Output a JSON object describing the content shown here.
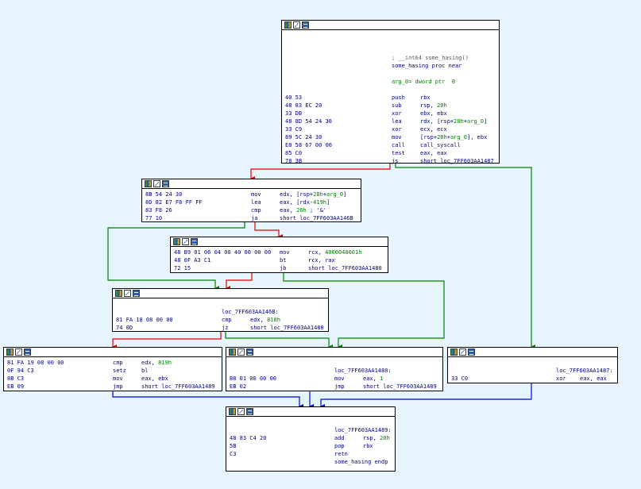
{
  "graph": {
    "colors": {
      "background": "#e6f5fd",
      "edge_taken": "#008000",
      "edge_not_taken": "#e00000",
      "edge_unconditional": "#0000e0"
    },
    "blocks": [
      {
        "id": "some_hasing",
        "rows": [
          {
            "bytes": "",
            "label": "; __int64 some_hasing()",
            "label_kind": "comment"
          },
          {
            "bytes": "",
            "label": "some_hasing proc near",
            "label_kind": "func"
          },
          {
            "bytes": "",
            "label": ""
          },
          {
            "bytes": "",
            "label": "arg_0= dword ptr  8",
            "label_kind": "arg"
          },
          {
            "bytes": "",
            "label": ""
          },
          {
            "bytes": "40 53",
            "mnem": "push",
            "ops": "rbx"
          },
          {
            "bytes": "48 83 EC 20",
            "mnem": "sub",
            "ops": "rsp, 20h"
          },
          {
            "bytes": "33 DB",
            "mnem": "xor",
            "ops": "ebx, ebx"
          },
          {
            "bytes": "48 8D 54 24 30",
            "mnem": "lea",
            "ops": "rdx, [rsp+28h+arg_0]"
          },
          {
            "bytes": "33 C9",
            "mnem": "xor",
            "ops": "ecx, ecx"
          },
          {
            "bytes": "89 5C 24 30",
            "mnem": "mov",
            "ops": "[rsp+28h+arg_0], ebx"
          },
          {
            "bytes": "E8 58 67 00 00",
            "mnem": "call",
            "ops": "call_syscall"
          },
          {
            "bytes": "85 C0",
            "mnem": "test",
            "ops": "eax, eax"
          },
          {
            "bytes": "78 3B",
            "mnem": "js",
            "ops": "short loc_7FF603AA1487"
          }
        ]
      },
      {
        "id": "blk_cmp26",
        "rows": [
          {
            "bytes": "8B 54 24 30",
            "mnem": "mov",
            "ops": "edx, [rsp+28h+arg_0]"
          },
          {
            "bytes": "8D 82 E7 F8 FF FF",
            "mnem": "lea",
            "ops": "eax, [rdx-419h]"
          },
          {
            "bytes": "83 F8 26",
            "mnem": "cmp",
            "ops": "eax, 26h ; '&'"
          },
          {
            "bytes": "77 10",
            "mnem": "ja",
            "ops": "short loc_7FF603AA146B"
          }
        ]
      },
      {
        "id": "blk_bt",
        "rows": [
          {
            "bytes": "48 B9 01 06 04 00 40 00 00 00",
            "mnem": "mov",
            "ops": "rcx, 4000040601h"
          },
          {
            "bytes": "48 0F A3 C1",
            "mnem": "bt",
            "ops": "rcx, rax"
          },
          {
            "bytes": "72 15",
            "mnem": "jb",
            "ops": "short loc_7FF603AA1480"
          }
        ]
      },
      {
        "id": "loc_146B",
        "rows": [
          {
            "bytes": "",
            "label": ""
          },
          {
            "bytes": "",
            "label": "loc_7FF603AA146B:",
            "label_kind": "label"
          },
          {
            "bytes": "81 FA 18 08 00 00",
            "mnem": "cmp",
            "ops": "edx, 818h"
          },
          {
            "bytes": "74 0D",
            "mnem": "jz",
            "ops": "short loc_7FF603AA1480"
          }
        ]
      },
      {
        "id": "blk_setz",
        "rows": [
          {
            "bytes": "81 FA 19 08 00 00",
            "mnem": "cmp",
            "ops": "edx, 819h"
          },
          {
            "bytes": "0F 94 C3",
            "mnem": "setz",
            "ops": "bl"
          },
          {
            "bytes": "8B C3",
            "mnem": "mov",
            "ops": "eax, ebx"
          },
          {
            "bytes": "EB 09",
            "mnem": "jmp",
            "ops": "short loc_7FF603AA1489"
          }
        ]
      },
      {
        "id": "loc_1480",
        "rows": [
          {
            "bytes": "",
            "label": ""
          },
          {
            "bytes": "",
            "label": "loc_7FF603AA1480:",
            "label_kind": "label"
          },
          {
            "bytes": "B8 01 00 00 00",
            "mnem": "mov",
            "ops": "eax, 1"
          },
          {
            "bytes": "EB 02",
            "mnem": "jmp",
            "ops": "short loc_7FF603AA1489"
          }
        ]
      },
      {
        "id": "loc_1487",
        "rows": [
          {
            "bytes": "",
            "label": ""
          },
          {
            "bytes": "",
            "label": "loc_7FF603AA1487:",
            "label_kind": "label"
          },
          {
            "bytes": "33 C0",
            "mnem": "xor",
            "ops": "eax, eax"
          }
        ]
      },
      {
        "id": "loc_1489",
        "rows": [
          {
            "bytes": "",
            "label": ""
          },
          {
            "bytes": "",
            "label": "loc_7FF603AA1489:",
            "label_kind": "label"
          },
          {
            "bytes": "48 83 C4 20",
            "mnem": "add",
            "ops": "rsp, 20h"
          },
          {
            "bytes": "5B",
            "mnem": "pop",
            "ops": "rbx"
          },
          {
            "bytes": "C3",
            "mnem": "retn",
            "ops": ""
          },
          {
            "bytes": "",
            "label": "some_hasing endp",
            "label_kind": "func"
          }
        ]
      }
    ],
    "edges": [
      {
        "from": "some_hasing",
        "to": "blk_cmp26",
        "kind": "not_taken"
      },
      {
        "from": "some_hasing",
        "to": "loc_1487",
        "kind": "taken"
      },
      {
        "from": "blk_cmp26",
        "to": "blk_bt",
        "kind": "not_taken"
      },
      {
        "from": "blk_cmp26",
        "to": "loc_146B",
        "kind": "taken"
      },
      {
        "from": "blk_bt",
        "to": "loc_146B",
        "kind": "not_taken"
      },
      {
        "from": "blk_bt",
        "to": "loc_1480",
        "kind": "taken"
      },
      {
        "from": "loc_146B",
        "to": "blk_setz",
        "kind": "not_taken"
      },
      {
        "from": "loc_146B",
        "to": "loc_1480",
        "kind": "taken"
      },
      {
        "from": "blk_setz",
        "to": "loc_1489",
        "kind": "unconditional"
      },
      {
        "from": "loc_1480",
        "to": "loc_1489",
        "kind": "unconditional"
      },
      {
        "from": "loc_1487",
        "to": "loc_1489",
        "kind": "unconditional"
      }
    ],
    "title_icons": [
      "color-palette-icon",
      "graph-view-icon",
      "text-view-icon"
    ]
  }
}
